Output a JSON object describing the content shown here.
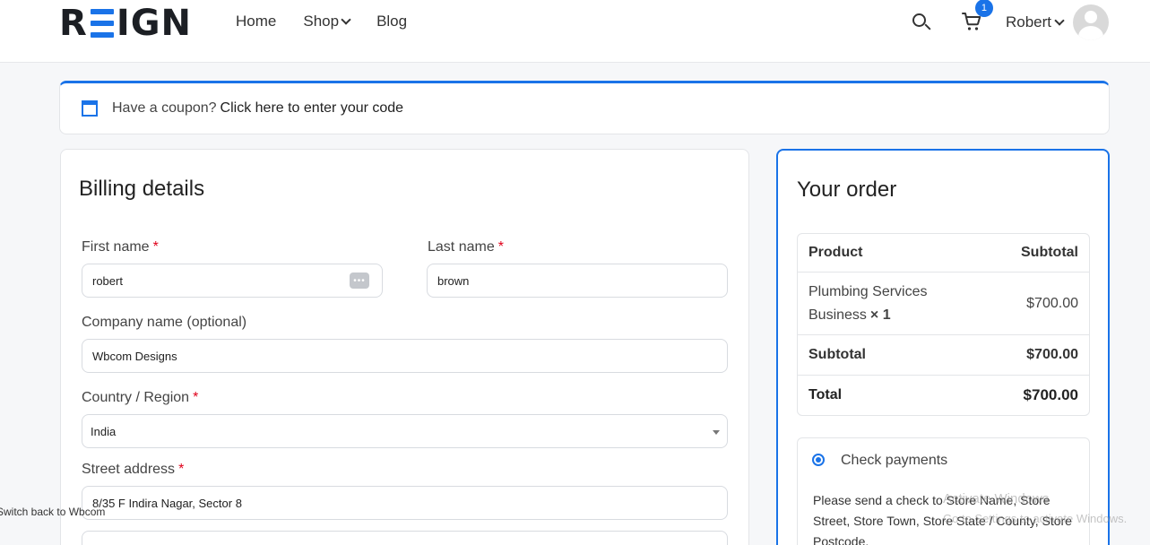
{
  "brand": {
    "logo_text": "REIGN",
    "accent_color": "#1a73e8"
  },
  "nav": {
    "home": "Home",
    "shop": "Shop",
    "blog": "Blog"
  },
  "header": {
    "cart_count": "1",
    "user_name": "Robert"
  },
  "coupon": {
    "prompt": "Have a coupon?",
    "link": "Click here to enter your code"
  },
  "billing": {
    "title": "Billing details",
    "first_name_label": "First name",
    "first_name_value": "robert",
    "last_name_label": "Last name",
    "last_name_value": "brown",
    "company_label": "Company name (optional)",
    "company_value": "Wbcom Designs",
    "country_label": "Country / Region",
    "country_value": "India",
    "street_label": "Street address",
    "street_value": "8/35 F Indira Nagar, Sector 8",
    "required_mark": "*"
  },
  "order": {
    "title": "Your order",
    "col_product": "Product",
    "col_subtotal": "Subtotal",
    "item_name": "Plumbing Services Business",
    "item_qty": "× 1",
    "item_price": "$700.00",
    "subtotal_label": "Subtotal",
    "subtotal_value": "$700.00",
    "total_label": "Total",
    "total_value": "$700.00"
  },
  "payment": {
    "method": "Check payments",
    "description": "Please send a check to Store Name, Store Street, Store Town, Store State / County, Store Postcode."
  },
  "footer": {
    "switch_back": "Switch back to Wbcom"
  },
  "watermark": {
    "line1": "Activate Windows",
    "line2": "Go to Settings to activate Windows."
  }
}
